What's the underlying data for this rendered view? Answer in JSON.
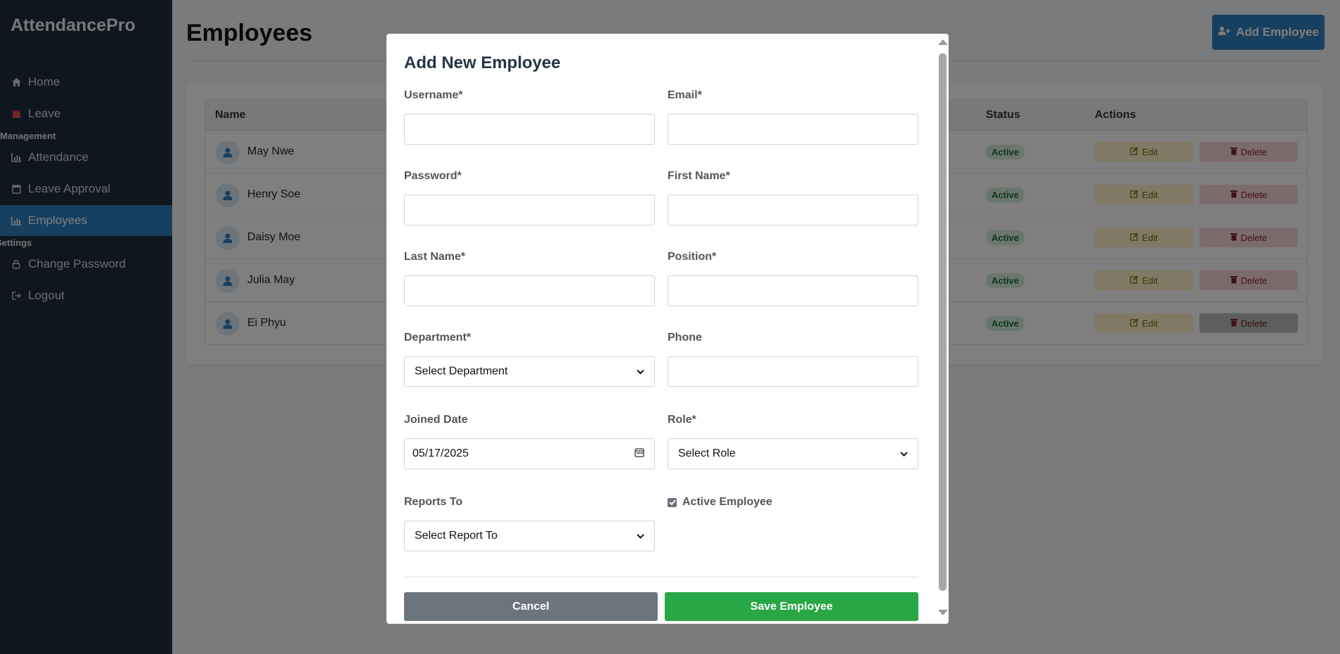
{
  "sidebar": {
    "brand": "AttendancePro",
    "items": [
      {
        "label": "Home",
        "icon": "home-icon"
      },
      {
        "label": "Leave",
        "icon": "calendar-icon"
      },
      {
        "label": "Attendance",
        "icon": "chart-icon"
      },
      {
        "label": "Leave Approval",
        "icon": "calendar-check-icon"
      },
      {
        "label": "Employees",
        "icon": "chart-icon"
      },
      {
        "label": "Change Password",
        "icon": "lock-icon"
      },
      {
        "label": "Logout",
        "icon": "logout-icon"
      }
    ],
    "sections": {
      "management": "Management",
      "settings": "Settings"
    },
    "active_item": "Employees"
  },
  "main": {
    "title": "Employees",
    "add_button": "Add Employee",
    "table": {
      "headers": [
        "Name",
        "Status",
        "Actions"
      ],
      "rows": [
        {
          "name": "May Nwe",
          "status": "Active"
        },
        {
          "name": "Henry Soe",
          "status": "Active"
        },
        {
          "name": "Daisy Moe",
          "status": "Active"
        },
        {
          "name": "Julia May",
          "status": "Active"
        },
        {
          "name": "Ei Phyu",
          "status": "Active"
        }
      ],
      "edit_label": "Edit",
      "delete_label": "Delete"
    }
  },
  "modal": {
    "title": "Add New Employee",
    "labels": {
      "username": "Username*",
      "email": "Email*",
      "password": "Password*",
      "first_name": "First Name*",
      "last_name": "Last Name*",
      "position": "Position*",
      "department": "Department*",
      "phone": "Phone",
      "joined_date": "Joined Date",
      "role": "Role*",
      "reports_to": "Reports To",
      "active": "Active Employee"
    },
    "values": {
      "department": "Select Department",
      "joined_date": "05/17/2025",
      "role": "Select Role",
      "reports_to": "Select Report To",
      "active_checked": true
    },
    "buttons": {
      "cancel": "Cancel",
      "save": "Save Employee"
    }
  },
  "colors": {
    "sidebar_bg": "#1f2d3d",
    "accent": "#2f7fc1",
    "save": "#28a745",
    "cancel": "#6c757d"
  }
}
